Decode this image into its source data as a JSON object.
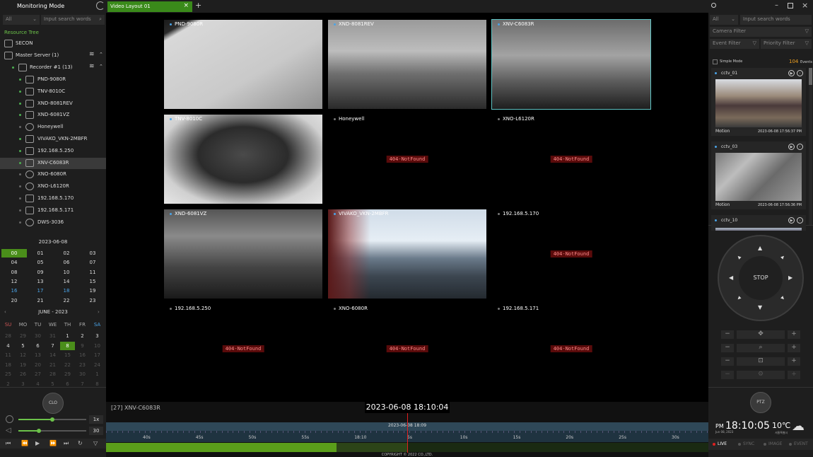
{
  "app": {
    "title": "Monitoring Mode"
  },
  "left": {
    "filter_all": "All",
    "search_placeholder": "Input search words",
    "resource_tree_label": "Resource Tree",
    "root": "SECON",
    "server": "Master Server (1)",
    "recorder": "Recorder #1 (13)",
    "devices": [
      "PND-9080R",
      "TNV-8010C",
      "XND-8081REV",
      "XND-6081VZ",
      "Honeywell",
      "VIVAKO_VKN-2MBFR",
      "192.168.5.250",
      "XNV-C6083R",
      "XNO-6080R",
      "XNO-L6120R",
      "192.168.5.170",
      "192.168.5.171",
      "DWS-3036"
    ],
    "date": "2023-06-08",
    "hours": [
      "00",
      "01",
      "02",
      "03",
      "04",
      "05",
      "06",
      "07",
      "08",
      "09",
      "10",
      "11",
      "12",
      "13",
      "14",
      "15",
      "16",
      "17",
      "18",
      "19",
      "20",
      "21",
      "22",
      "23"
    ],
    "month_label": "JUNE - 2023",
    "weekdays": [
      "SU",
      "MO",
      "TU",
      "WE",
      "TH",
      "FR",
      "SA"
    ],
    "weeks": [
      [
        "28",
        "29",
        "30",
        "31",
        "1",
        "2",
        "3"
      ],
      [
        "4",
        "5",
        "6",
        "7",
        "8",
        "9",
        "10"
      ],
      [
        "11",
        "12",
        "13",
        "14",
        "15",
        "16",
        "17"
      ],
      [
        "18",
        "19",
        "20",
        "21",
        "22",
        "23",
        "24"
      ],
      [
        "25",
        "26",
        "27",
        "28",
        "29",
        "30",
        "1"
      ],
      [
        "2",
        "3",
        "4",
        "5",
        "6",
        "7",
        "8"
      ]
    ],
    "clo_label": "CLO",
    "speed_label": "1x",
    "volume_label": "30"
  },
  "tabs": [
    {
      "label": "Video Layout 01"
    }
  ],
  "tab_add": "+",
  "cameras": [
    {
      "name": "PND-9080R",
      "err": ""
    },
    {
      "name": "XND-8081REV",
      "err": ""
    },
    {
      "name": "XNV-C6083R",
      "err": ""
    },
    {
      "name": "TNV-8010C",
      "err": ""
    },
    {
      "name": "Honeywell",
      "err": "404-NotFound"
    },
    {
      "name": "XNO-L6120R",
      "err": "404-NotFound"
    },
    {
      "name": "XND-6081VZ",
      "err": ""
    },
    {
      "name": "VIVAKO_VKN-2MBFR",
      "err": ""
    },
    {
      "name": "192.168.5.170",
      "err": "404-NotFound"
    },
    {
      "name": "192.168.5.250",
      "err": "404-NotFound"
    },
    {
      "name": "XNO-6080R",
      "err": "404-NotFound"
    },
    {
      "name": "192.168.5.171",
      "err": "404-NotFound"
    }
  ],
  "timeline": {
    "channel": "[27] XNV-C6083R",
    "datetime": "2023-06-08 18:10:04",
    "marker": "2023-06-08 18:09",
    "labels": [
      "40s",
      "45s",
      "50s",
      "55s",
      "18:10",
      "5s",
      "10s",
      "15s",
      "20s",
      "25s",
      "30s"
    ],
    "copyright": "COPYRIGHT © 2022          CO.,LTD."
  },
  "right": {
    "filter_all": "All",
    "search_placeholder": "Input search words",
    "camera_filter": "Camera Filter",
    "event_filter": "Event Filter",
    "priority_filter": "Priority Filter",
    "simple_mode": "Simple Mode",
    "events_count": "104",
    "events_label": "Events",
    "events": [
      {
        "name": "cctv_01",
        "type": "Motion",
        "time": "2023-06-08 17:56:37 PM"
      },
      {
        "name": "cctv_03",
        "type": "Motion",
        "time": "2023-06-08 17:56:36 PM"
      },
      {
        "name": "cctv_10",
        "type": "",
        "time": ""
      }
    ],
    "stop_label": "STOP",
    "ptz_label": "PTZ",
    "ampm": "PM",
    "clock": "18:10:05",
    "clock_date": "Jun 08, 2023",
    "temp": "10℃",
    "weather": "서울특별시",
    "status": [
      "LIVE",
      "SYNC",
      "IMAGE",
      "EVENT"
    ]
  },
  "colors": {
    "accent_green": "#4a8e1a",
    "select_cyan": "#5ec4c4",
    "error_red": "#5a0b0b",
    "timeline_blue": "#2f4858"
  }
}
